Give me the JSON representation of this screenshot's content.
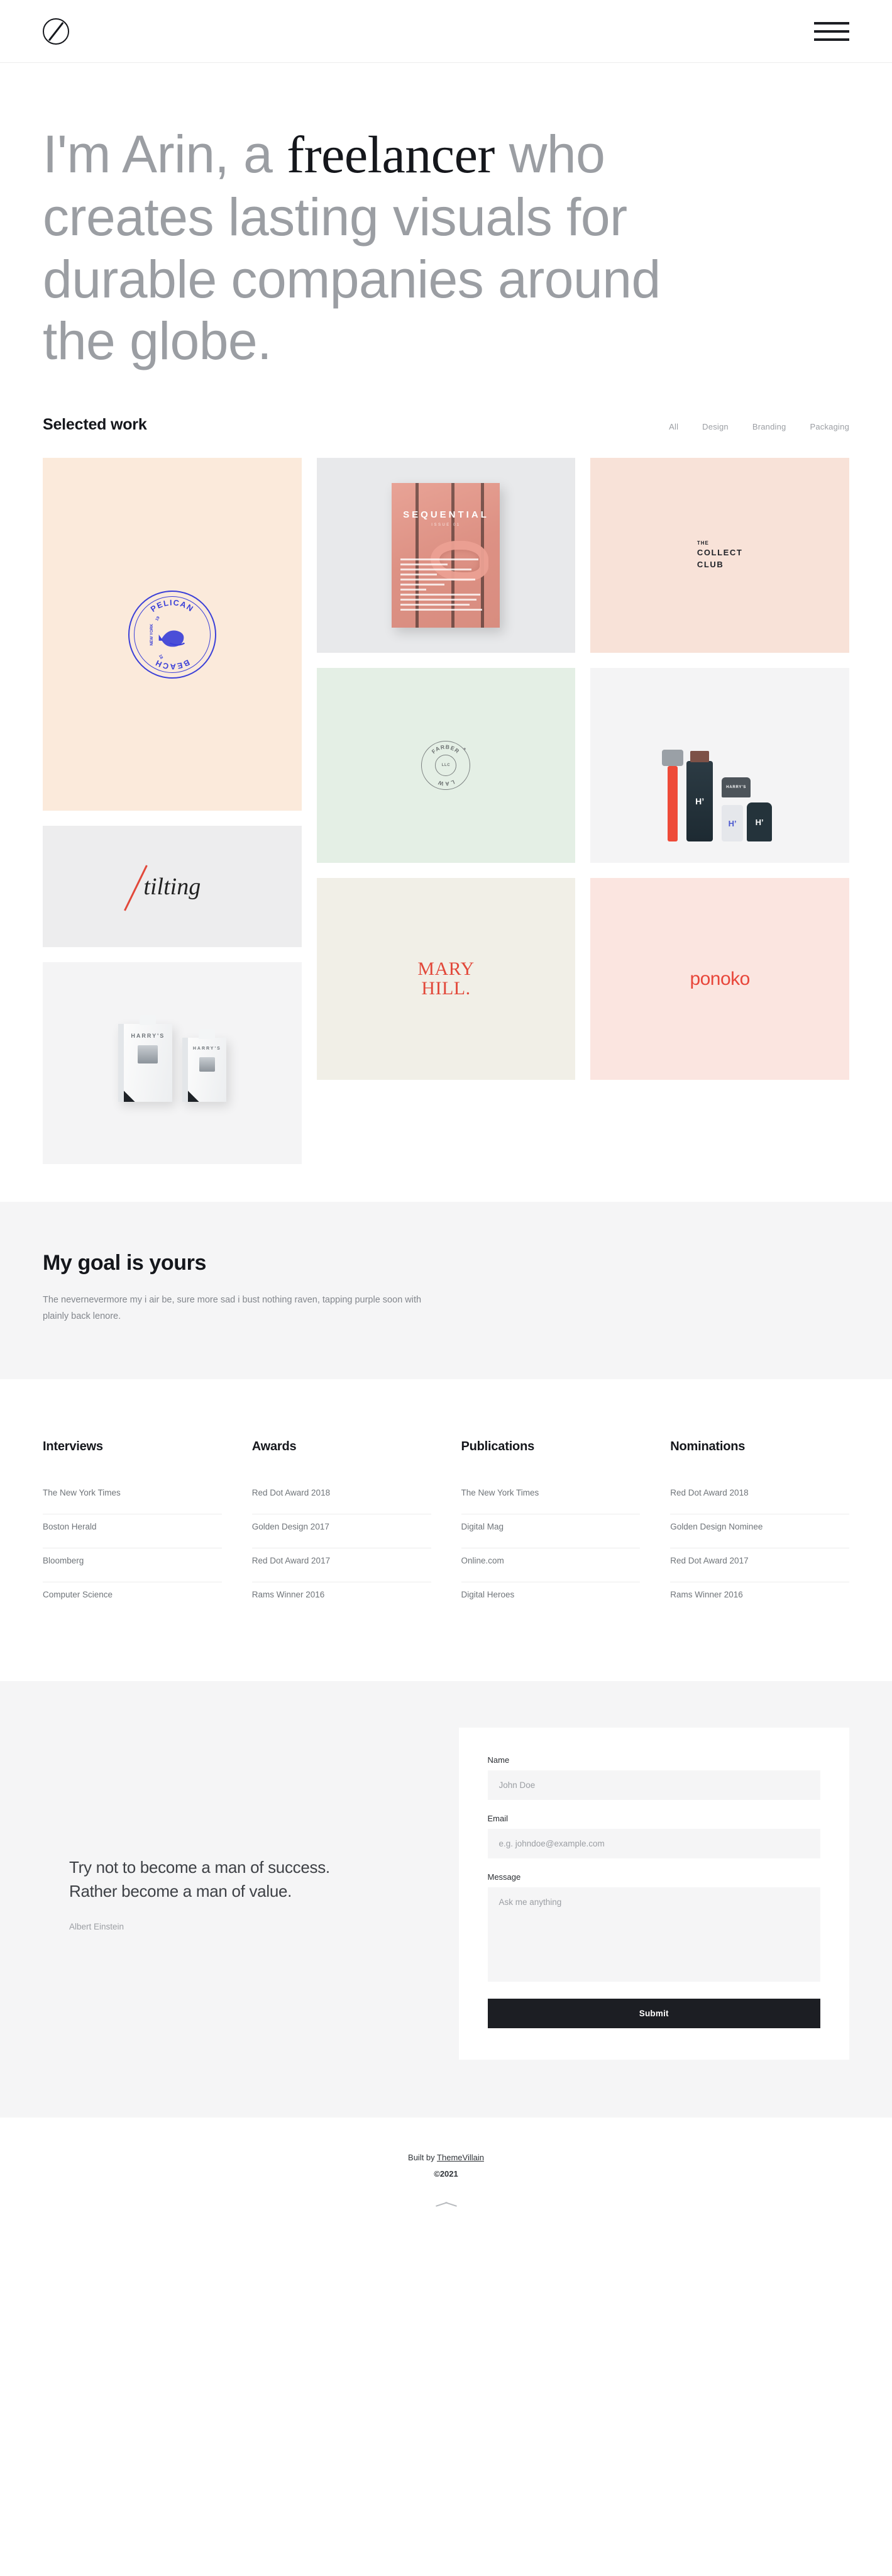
{
  "header": {
    "logo_icon": "circle-slash-logo",
    "menu_icon": "hamburger-menu-icon"
  },
  "hero": {
    "line_1_prefix": "I'm Arin, a ",
    "accent_word": "freelancer",
    "rest": "who creates lasting visuals for durable companies around the globe."
  },
  "work": {
    "title": "Selected work",
    "filters": [
      {
        "label": "All",
        "active": true
      },
      {
        "label": "Design",
        "active": false
      },
      {
        "label": "Branding",
        "active": false
      },
      {
        "label": "Packaging",
        "active": false
      }
    ],
    "items": [
      {
        "name": "pelican-beach",
        "label": "PELICAN BEACH",
        "sub": "NEW YORK",
        "year_left": "19",
        "year_right": "18",
        "bg": "#fbeadb",
        "accent": "#3b40d8"
      },
      {
        "name": "tilting",
        "label": "tilting",
        "bg": "#ededee",
        "accent": "#e2483a"
      },
      {
        "name": "harrys-cartridges",
        "label": "HARRY'S",
        "bg": "#f4f4f5"
      },
      {
        "name": "sequential-magazine",
        "label": "SEQUENTIAL",
        "sub": "ISSUE 01",
        "bg": "#e8e9eb"
      },
      {
        "name": "farber-law",
        "label": "FARBER LAW",
        "sub": "LLC",
        "bg": "#e4efe5"
      },
      {
        "name": "mary-hill",
        "label_line1": "MARY",
        "label_line2": "HILL.",
        "bg": "#f1efe7",
        "accent": "#e2483a"
      },
      {
        "name": "the-collect-club",
        "the": "THE",
        "label_line1": "COLLECT",
        "label_line2": "CLUB",
        "bg": "#f8e2d8"
      },
      {
        "name": "harrys-grooming",
        "label": "HARRY'S",
        "bg": "#f4f4f5"
      },
      {
        "name": "ponoko",
        "label": "ponoko",
        "bg": "#fbe5e0",
        "accent": "#e8463a"
      }
    ]
  },
  "goal": {
    "title": "My goal is yours",
    "text": "The nevernevermore my i air be, sure more sad i bust nothing raven, tapping purple soon with plainly back lenore."
  },
  "credentials": [
    {
      "title": "Interviews",
      "items": [
        "The New York Times",
        "Boston Herald",
        "Bloomberg",
        "Computer Science"
      ]
    },
    {
      "title": "Awards",
      "items": [
        "Red Dot Award 2018",
        "Golden Design 2017",
        "Red Dot Award 2017",
        "Rams Winner 2016"
      ]
    },
    {
      "title": "Publications",
      "items": [
        "The New York Times",
        "Digital Mag",
        "Online.com",
        "Digital Heroes"
      ]
    },
    {
      "title": "Nominations",
      "items": [
        "Red Dot Award 2018",
        "Golden Design Nominee",
        "Red Dot Award 2017",
        "Rams Winner 2016"
      ]
    }
  ],
  "contact": {
    "quote": "Try not to become a man of success. Rather become a man of value.",
    "author": "Albert Einstein",
    "form": {
      "name_label": "Name",
      "name_placeholder": "John Doe",
      "name_value": "",
      "email_label": "Email",
      "email_placeholder": "e.g. johndoe@example.com",
      "email_value": "",
      "message_label": "Message",
      "message_placeholder": "Ask me anything",
      "message_value": "",
      "submit_label": "Submit"
    }
  },
  "footer": {
    "built_prefix": "Built by ",
    "built_link": "ThemeVillain",
    "copyright": "©2021",
    "scroll_icon": "chevron-up-icon"
  },
  "colors": {
    "ink": "#15171c",
    "muted": "#9b9ea3",
    "panel": "#f5f5f6",
    "accent_red": "#e2483a",
    "accent_blue": "#3b40d8"
  }
}
